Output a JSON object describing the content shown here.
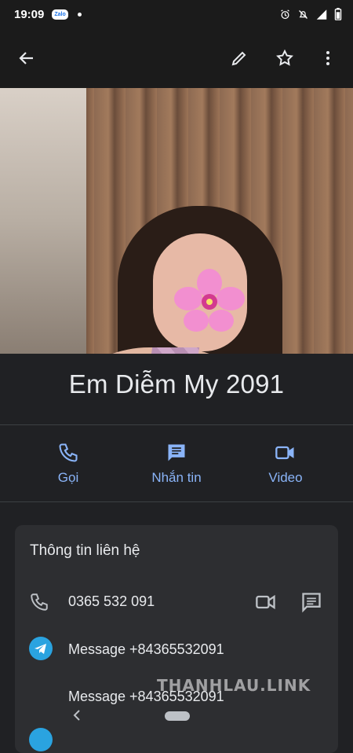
{
  "status_bar": {
    "time": "19:09",
    "notification_app": "Zalo",
    "icons": [
      "alarm-icon",
      "silent-icon",
      "signal-icon",
      "battery-icon"
    ]
  },
  "app_bar": {
    "icons": [
      "back-arrow-icon",
      "edit-pencil-icon",
      "star-outline-icon",
      "more-vert-icon"
    ]
  },
  "contact": {
    "name": "Em Diễm My 2091"
  },
  "actions": [
    {
      "label": "Gọi",
      "icon": "phone-icon"
    },
    {
      "label": "Nhắn tin",
      "icon": "message-icon"
    },
    {
      "label": "Video",
      "icon": "video-icon"
    }
  ],
  "contact_info": {
    "title": "Thông tin liên hệ",
    "phone": "0365 532 091",
    "telegram_message_1": "Message +84365532091",
    "telegram_message_2": "Message +84365532091"
  },
  "watermark": "THANHLAU.LINK",
  "colors": {
    "background": "#202124",
    "accent": "#8ab4f8",
    "card": "#2d2e31",
    "telegram": "#2aa3e0"
  }
}
